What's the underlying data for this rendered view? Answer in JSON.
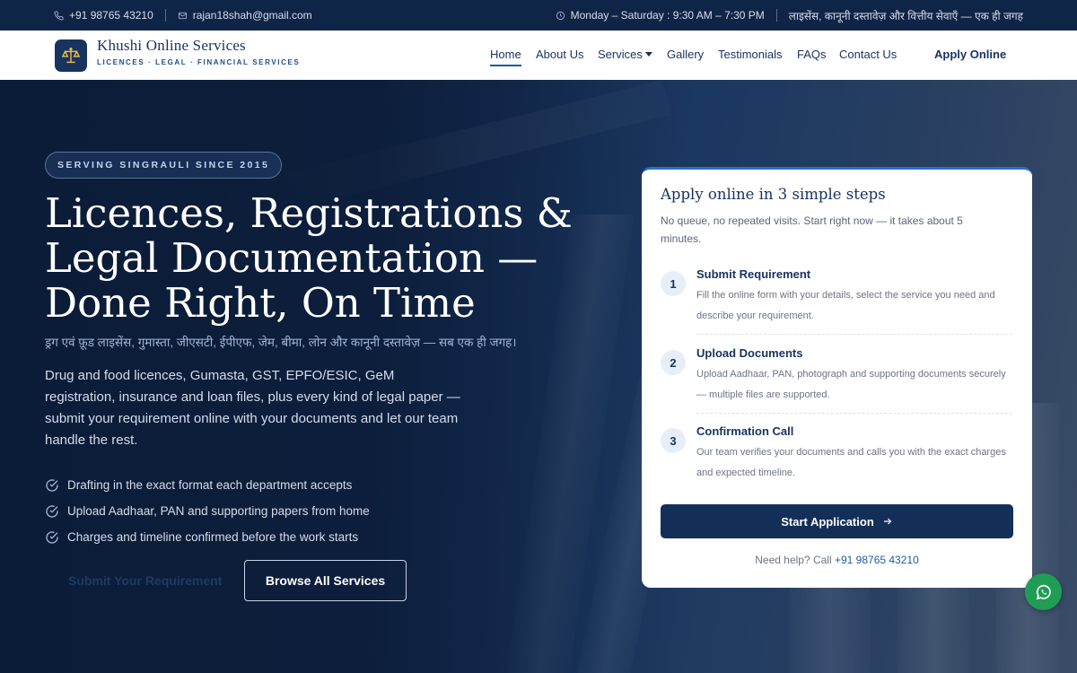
{
  "topbar": {
    "phone": "+91 98765 43210",
    "email": "rajan18shah@gmail.com",
    "hours": "Monday – Saturday : 9:30 AM – 7:30 PM",
    "tagline_hindi": "लाइसेंस, कानूनी दस्तावेज़ और वित्तीय सेवाएँ — एक ही जगह"
  },
  "brand": {
    "name": "Khushi Online Services",
    "tagline": "LICENCES · LEGAL · FINANCIAL SERVICES"
  },
  "nav": {
    "home": "Home",
    "about": "About Us",
    "services": "Services",
    "gallery": "Gallery",
    "testimonials": "Testimonials",
    "faqs": "FAQs",
    "contact": "Contact Us",
    "apply": "Apply Online"
  },
  "hero": {
    "badge": "SERVING SINGRAULI SINCE 2015",
    "title": "Licences, Registrations & Legal Documentation — Done Right, On Time",
    "hindi": "ड्रग एवं फ़ूड लाइसेंस, गुमास्ता, जीएसटी, ईपीएफ, जेम, बीमा, लोन और कानूनी दस्तावेज़ — सब एक ही जगह।",
    "lead": "Drug and food licences, Gumasta, GST, EPFO/ESIC, GeM registration, insurance and loan files, plus every kind of legal paper — submit your requirement online with your documents and let our team handle the rest.",
    "checks": [
      "Drafting in the exact format each department accepts",
      "Upload Aadhaar, PAN and supporting papers from home",
      "Charges and timeline confirmed before the work starts"
    ],
    "cta_primary": "Submit Your Requirement",
    "cta_secondary": "Browse All Services"
  },
  "card": {
    "title": "Apply online in 3 simple steps",
    "subtitle": "No queue, no repeated visits. Start right now — it takes about 5 minutes.",
    "steps": [
      {
        "num": "1",
        "title": "Submit Requirement",
        "desc": "Fill the online form with your details, select the service you need and describe your requirement."
      },
      {
        "num": "2",
        "title": "Upload Documents",
        "desc": "Upload Aadhaar, PAN, photograph and supporting documents securely — multiple files are supported."
      },
      {
        "num": "3",
        "title": "Confirmation Call",
        "desc": "Our team verifies your documents and calls you with the exact charges and expected timeline."
      }
    ],
    "start_button": "Start Application",
    "help_text": "Need help? Call",
    "help_phone": "+91 98765 43210"
  },
  "icons": {
    "phone": "phone-icon",
    "email": "mail-icon",
    "clock": "clock-icon",
    "logo": "scales-icon",
    "check": "check-circle-icon",
    "arrow": "arrow-right-icon",
    "whatsapp": "whatsapp-icon"
  },
  "colors": {
    "navy": "#17335e",
    "accent": "#2d6fc7",
    "whatsapp": "#1f9d55"
  }
}
